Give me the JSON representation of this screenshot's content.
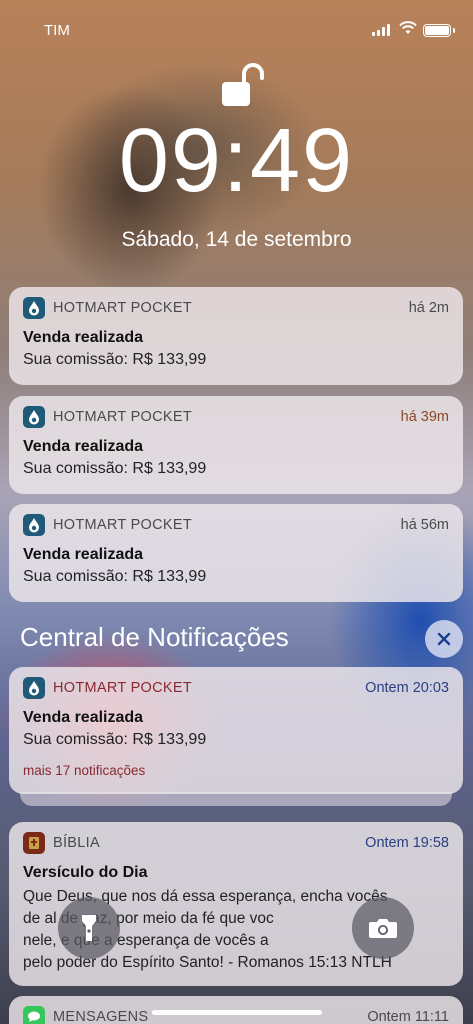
{
  "status_bar": {
    "carrier": "TIM"
  },
  "lock_screen": {
    "time": "09:49",
    "date": "Sábado, 14 de setembro"
  },
  "recent_notifications": [
    {
      "app": "HOTMART POCKET",
      "time": "há 2m",
      "title": "Venda realizada",
      "body": "Sua comissão: R$ 133,99"
    },
    {
      "app": "HOTMART POCKET",
      "time": "há 39m",
      "title": "Venda realizada",
      "body": "Sua comissão: R$ 133,99"
    },
    {
      "app": "HOTMART POCKET",
      "time": "há 56m",
      "title": "Venda realizada",
      "body": "Sua comissão: R$ 133,99"
    }
  ],
  "notification_center": {
    "title": "Central de Notificações",
    "clear_icon": "close-icon"
  },
  "grouped_notification": {
    "app": "HOTMART POCKET",
    "time": "Ontem 20:03",
    "title": "Venda realizada",
    "body": "Sua comissão: R$ 133,99",
    "more": "mais 17 notificações"
  },
  "bible_notification": {
    "app": "BÍBLIA",
    "time": "Ontem 19:58",
    "title": "Versículo do Dia",
    "lines": [
      "Que Deus, que nos dá essa esperança, encha vocês",
      "de al        de paz, por meio da fé que voc",
      "nele,        e que a esperança de vocês a",
      "pelo poder do Espírito Santo! - Romanos 15:13 NTLH"
    ]
  },
  "messages_notification": {
    "app": "MENSAGENS",
    "time": "Ontem 11:11"
  },
  "quick_actions": {
    "flashlight": "flashlight-icon",
    "camera": "camera-icon"
  }
}
